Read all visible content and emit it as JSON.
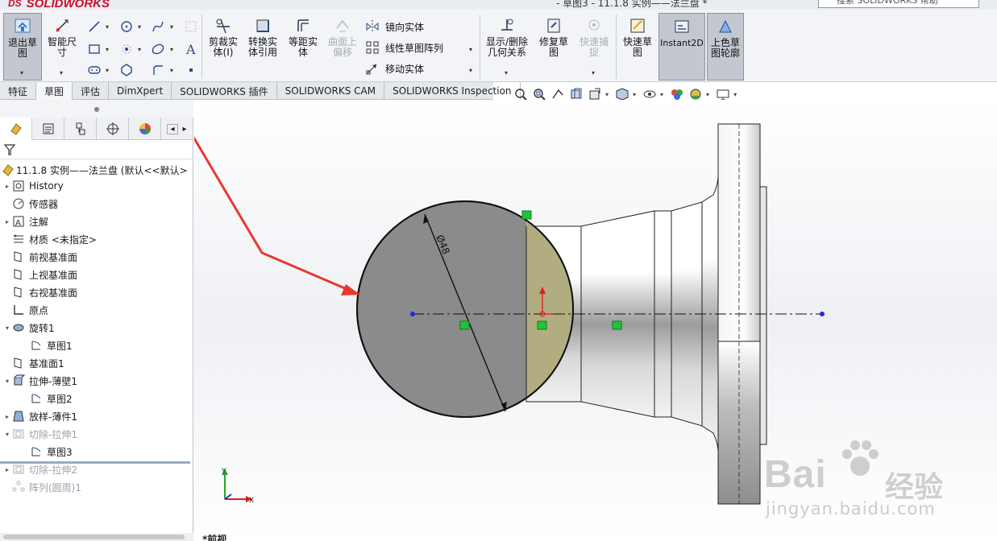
{
  "titlebar": {
    "logo_prefix": "DS",
    "logo_text": "SOLIDWORKS",
    "document_title": "- 草图3 - 11.1.8 实例——法兰盘 *",
    "help_search_placeholder": "搜索 SOLIDWORKS 帮助"
  },
  "ribbon": {
    "exit_sketch": "退出草\n图",
    "smart_dimension": "智能尺\n寸",
    "trim_entities": "剪裁实\n体(I)",
    "convert_entities": "转换实\n体引用",
    "offset_entities": "等距实\n体",
    "offset_on_surface": "曲面上\n偏移",
    "mirror_entities": "镜向实体",
    "linear_pattern": "线性草图阵列",
    "move_entities": "移动实体",
    "display_delete_relations": "显示/删除\n几何关系",
    "repair_sketch": "修复草\n图",
    "quick_snaps": "快速捕\n捉",
    "rapid_sketch": "快速草\n图",
    "instant2d": "Instant2D",
    "shaded_contours": "上色草\n图轮廓"
  },
  "tabs": [
    "特征",
    "草图",
    "评估",
    "DimXpert",
    "SOLIDWORKS 插件",
    "SOLIDWORKS CAM",
    "SOLIDWORKS Inspection"
  ],
  "active_tab": "草图",
  "tree": {
    "root": "11.1.8  实例——法兰盘  (默认<<默认>",
    "items": [
      {
        "label": "History",
        "expandable": true,
        "suppressed": false
      },
      {
        "label": "传感器",
        "expandable": false,
        "suppressed": false
      },
      {
        "label": "注解",
        "expandable": true,
        "suppressed": false
      },
      {
        "label": "材质 <未指定>",
        "expandable": false,
        "suppressed": false
      },
      {
        "label": "前视基准面",
        "expandable": false,
        "suppressed": false
      },
      {
        "label": "上视基准面",
        "expandable": false,
        "suppressed": false
      },
      {
        "label": "右视基准面",
        "expandable": false,
        "suppressed": false
      },
      {
        "label": "原点",
        "expandable": false,
        "suppressed": false
      },
      {
        "label": "旋转1",
        "expandable": true,
        "expanded": true,
        "suppressed": false
      },
      {
        "label": "草图1",
        "expandable": false,
        "suppressed": false
      },
      {
        "label": "基准面1",
        "expandable": false,
        "suppressed": false
      },
      {
        "label": "拉伸-薄壁1",
        "expandable": true,
        "expanded": true,
        "suppressed": false
      },
      {
        "label": "草图2",
        "expandable": false,
        "suppressed": false
      },
      {
        "label": "放样-薄件1",
        "expandable": true,
        "suppressed": false
      },
      {
        "label": "切除-拉伸1",
        "expandable": true,
        "expanded": true,
        "suppressed": true
      },
      {
        "label": "草图3",
        "expandable": false,
        "suppressed": false
      },
      {
        "label": "切除-拉伸2",
        "expandable": true,
        "suppressed": true
      },
      {
        "label": "阵列(圆周)1",
        "expandable": false,
        "suppressed": true
      }
    ]
  },
  "viewport": {
    "dimension_label": "Ø48",
    "triad_x": "X",
    "triad_y": "Y",
    "view_name": "*前视"
  },
  "watermark": {
    "brand": "Bai",
    "brand_cn": "经验",
    "url": "jingyan.baidu.com"
  },
  "colors": {
    "annotation_arrow": "#e8382f",
    "sketch_green": "#22c33a",
    "sketch_blue": "#1f2bd8",
    "part_gray": "#8c8c8c"
  }
}
